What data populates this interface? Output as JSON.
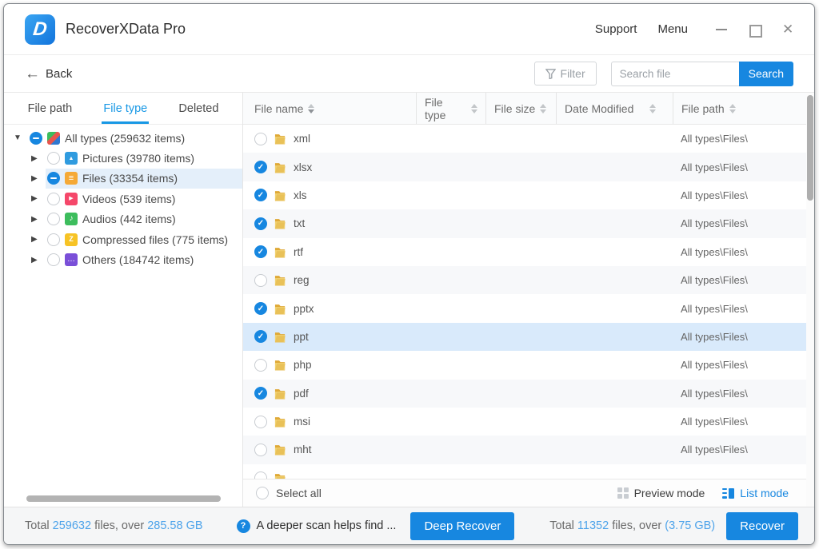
{
  "colors": {
    "accent": "#1787e0",
    "link_blue": "#4da3ea",
    "tab_active": "#1898e5",
    "selected_row": "#d9eafb"
  },
  "titlebar": {
    "app_title": "RecoverXData Pro",
    "support": "Support",
    "menu": "Menu"
  },
  "toolbar": {
    "back_label": "Back",
    "filter_label": "Filter",
    "search_placeholder": "Search file",
    "search_button": "Search"
  },
  "sidebar": {
    "tabs": [
      {
        "label": "File path",
        "active": false
      },
      {
        "label": "File type",
        "active": true
      },
      {
        "label": "Deleted",
        "active": false
      }
    ],
    "tree": [
      {
        "label": "All types (259632 items)",
        "check": "indeterminate",
        "arrow": "expanded",
        "icon": "all-types",
        "level": 0,
        "selected": false
      },
      {
        "label": "Pictures (39780 items)",
        "check": "unchecked",
        "arrow": "collapsed",
        "icon": "pictures",
        "level": 1,
        "selected": false
      },
      {
        "label": "Files (33354 items)",
        "check": "indeterminate",
        "arrow": "collapsed",
        "icon": "files",
        "level": 1,
        "selected": true
      },
      {
        "label": "Videos (539 items)",
        "check": "unchecked",
        "arrow": "collapsed",
        "icon": "videos",
        "level": 1,
        "selected": false
      },
      {
        "label": "Audios (442 items)",
        "check": "unchecked",
        "arrow": "collapsed",
        "icon": "audios",
        "level": 1,
        "selected": false
      },
      {
        "label": "Compressed files (775 items)",
        "check": "unchecked",
        "arrow": "collapsed",
        "icon": "compressed",
        "level": 1,
        "selected": false
      },
      {
        "label": "Others (184742 items)",
        "check": "unchecked",
        "arrow": "collapsed",
        "icon": "others",
        "level": 1,
        "selected": false
      }
    ]
  },
  "table": {
    "columns": [
      "File name",
      "File type",
      "File size",
      "Date Modified",
      "File path"
    ],
    "rows": [
      {
        "name": "xml",
        "checked": false,
        "selected": false,
        "type": "",
        "size": "",
        "date": "",
        "path": "All types\\Files\\"
      },
      {
        "name": "xlsx",
        "checked": true,
        "selected": false,
        "type": "",
        "size": "",
        "date": "",
        "path": "All types\\Files\\"
      },
      {
        "name": "xls",
        "checked": true,
        "selected": false,
        "type": "",
        "size": "",
        "date": "",
        "path": "All types\\Files\\"
      },
      {
        "name": "txt",
        "checked": true,
        "selected": false,
        "type": "",
        "size": "",
        "date": "",
        "path": "All types\\Files\\"
      },
      {
        "name": "rtf",
        "checked": true,
        "selected": false,
        "type": "",
        "size": "",
        "date": "",
        "path": "All types\\Files\\"
      },
      {
        "name": "reg",
        "checked": false,
        "selected": false,
        "type": "",
        "size": "",
        "date": "",
        "path": "All types\\Files\\"
      },
      {
        "name": "pptx",
        "checked": true,
        "selected": false,
        "type": "",
        "size": "",
        "date": "",
        "path": "All types\\Files\\"
      },
      {
        "name": "ppt",
        "checked": true,
        "selected": true,
        "type": "",
        "size": "",
        "date": "",
        "path": "All types\\Files\\"
      },
      {
        "name": "php",
        "checked": false,
        "selected": false,
        "type": "",
        "size": "",
        "date": "",
        "path": "All types\\Files\\"
      },
      {
        "name": "pdf",
        "checked": true,
        "selected": false,
        "type": "",
        "size": "",
        "date": "",
        "path": "All types\\Files\\"
      },
      {
        "name": "msi",
        "checked": false,
        "selected": false,
        "type": "",
        "size": "",
        "date": "",
        "path": "All types\\Files\\"
      },
      {
        "name": "mht",
        "checked": false,
        "selected": false,
        "type": "",
        "size": "",
        "date": "",
        "path": "All types\\Files\\"
      },
      {
        "name": "",
        "checked": false,
        "selected": false,
        "type": "",
        "size": "",
        "date": "",
        "path": ""
      }
    ],
    "footer": {
      "select_all": "Select all",
      "preview_mode": "Preview mode",
      "list_mode": "List mode"
    }
  },
  "statusbar": {
    "total_prefix": "Total",
    "total_files": "259632",
    "total_mid": "files, over",
    "total_size": "285.58 GB",
    "hint": "A deeper scan helps find ...",
    "deep_recover_button": "Deep Recover",
    "selected_prefix": "Total",
    "selected_files": "11352",
    "selected_mid": "files, over",
    "selected_size": "(3.75 GB)",
    "recover_button": "Recover"
  }
}
